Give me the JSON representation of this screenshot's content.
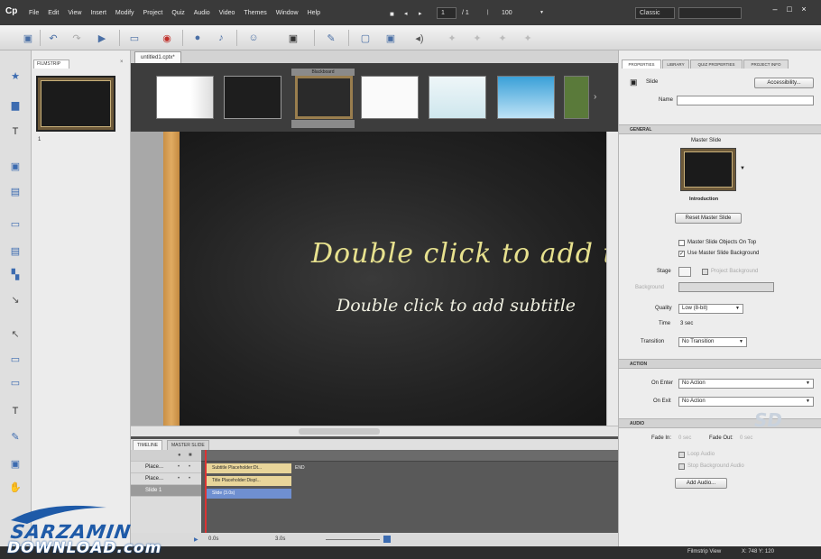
{
  "app": {
    "logo": "Cp",
    "menus": [
      "File",
      "Edit",
      "View",
      "Insert",
      "Modify",
      "Project",
      "Quiz",
      "Audio",
      "Video",
      "Themes",
      "Window",
      "Help"
    ],
    "page_current": "1",
    "page_sep": "/ 1",
    "zoom": "100",
    "workspace": "Classic"
  },
  "filmstrip": {
    "tab_label": "FILMSTRIP",
    "slide_number": "1"
  },
  "document": {
    "tab_label": "untitled1.cptx*"
  },
  "themes": {
    "selected_label": "Blackboard"
  },
  "stage": {
    "title_placeholder": "Double click to add title",
    "subtitle_placeholder": "Double click to add subtitle"
  },
  "timeline": {
    "tabs": [
      "TIMELINE",
      "MASTER SLIDE"
    ],
    "rows": [
      {
        "name": "Place...",
        "bar": "Subtitle Placeholder:Dt..."
      },
      {
        "name": "Place...",
        "bar": "Title Placeholder:Displ..."
      },
      {
        "name": "Slide 1",
        "bar": "Slide (3.0s)"
      }
    ],
    "end_label": "END",
    "time_readout": "0.0s",
    "duration_readout": "3.0s"
  },
  "properties": {
    "tabs": [
      "PROPERTIES",
      "LIBRARY",
      "QUIZ PROPERTIES",
      "PROJECT INFO"
    ],
    "type": "Slide",
    "accessibility_button": "Accessibility...",
    "name_label": "Name",
    "general_header": "GENERAL",
    "master_slide_label": "Master Slide",
    "master_slide_name": "Introduction",
    "reset_master_button": "Reset Master Slide",
    "master_objects_on_top": "Master Slide Objects On Top",
    "use_master_background": "Use Master Slide Background",
    "stage_label": "Stage",
    "project_background": "Project Background",
    "background_label": "Background",
    "quality_label": "Quality",
    "quality_value": "Low (8-bit)",
    "time_label": "Time",
    "time_value": "3 sec",
    "transition_label": "Transition",
    "transition_value": "No Transition",
    "action_header": "ACTION",
    "on_enter_label": "On Enter",
    "on_enter_value": "No Action",
    "on_exit_label": "On Exit",
    "on_exit_value": "No Action",
    "audio_header": "AUDIO",
    "fade_in_label": "Fade In:",
    "fade_in_value": "0 sec",
    "fade_out_label": "Fade Out:",
    "fade_out_value": "0 sec",
    "loop_audio": "Loop Audio",
    "stop_bg_audio": "Stop Background Audio",
    "add_audio_button": "Add Audio..."
  },
  "status": {
    "view": "Filmstrip View",
    "coords": "X: 748 Y: 120"
  },
  "watermark": {
    "line1": "SARZAMIN",
    "line2": "DOWNLOAD.com",
    "corner": "SD"
  },
  "colors": {
    "title_text": "#e7e18e",
    "accent_blue": "#1e5aa8",
    "board": "#222222"
  }
}
